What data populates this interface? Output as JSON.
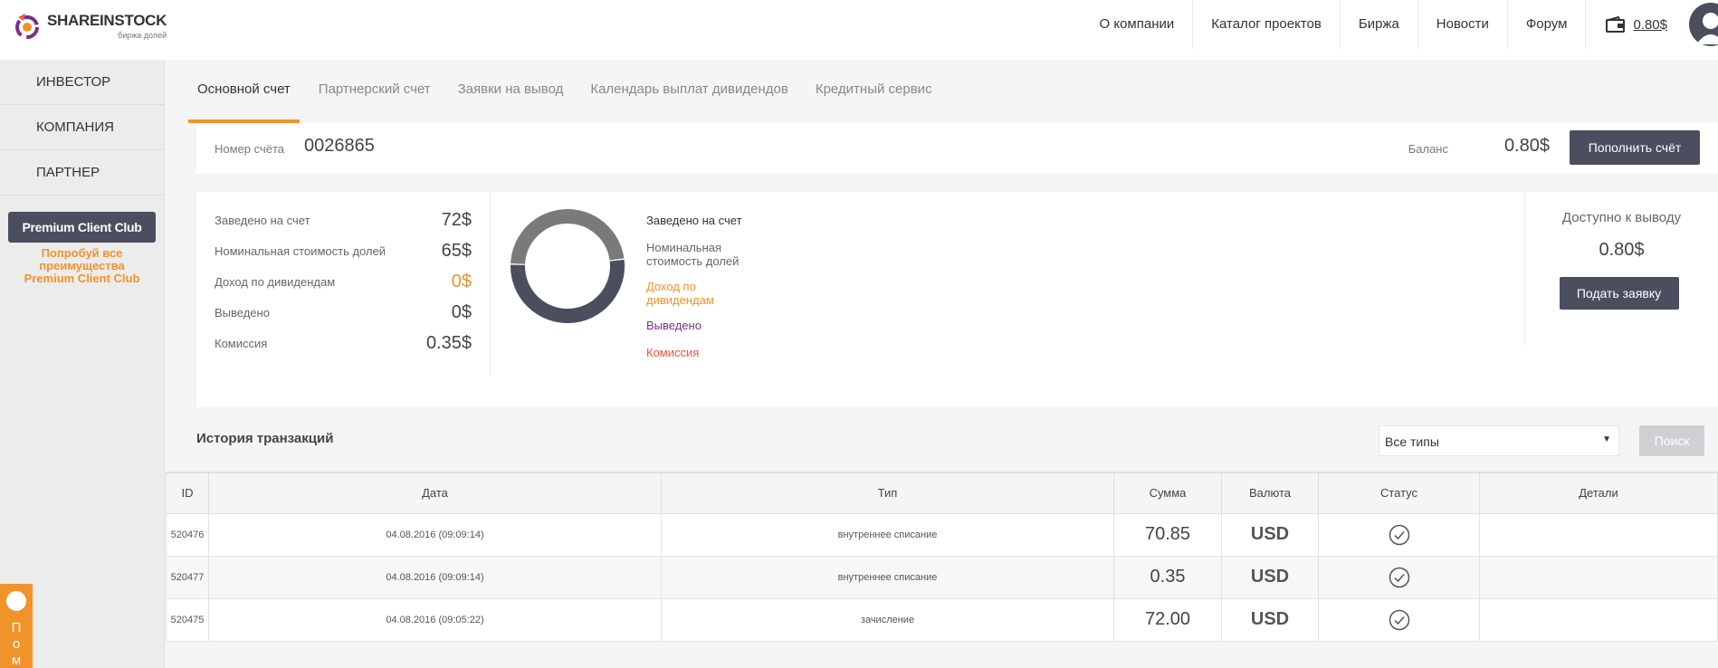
{
  "brand": {
    "name": "SHAREINSTOCK",
    "tagline": "биржа долей"
  },
  "topnav": {
    "items": [
      "О компании",
      "Каталог проектов",
      "Биржа",
      "Новости",
      "Форум"
    ],
    "wallet_amount": "0.80$"
  },
  "sidebar": {
    "items": [
      "ИНВЕСТОР",
      "КОМПАНИЯ",
      "ПАРТНЕР"
    ],
    "premium_button": "Premium Client Club",
    "premium_promo": "Попробуй все преимущества Premium Client Club",
    "help_letters": [
      "П",
      "о",
      "м"
    ]
  },
  "tabs": [
    "Основной счет",
    "Партнерский счет",
    "Заявки на вывод",
    "Календарь выплат дивидендов",
    "Кредитный сервис"
  ],
  "account": {
    "number_label": "Номер счёта",
    "number": "0026865",
    "balance_label": "Баланс",
    "balance": "0.80$",
    "topup_button": "Пополнить счёт"
  },
  "stats": {
    "rows": [
      {
        "label": "Заведено на счет",
        "value": "72$"
      },
      {
        "label": "Номинальная стоимость долей",
        "value": "65$"
      },
      {
        "label": "Доход по дивидендам",
        "value": "0$"
      },
      {
        "label": "Выведено",
        "value": "0$"
      },
      {
        "label": "Комиссия",
        "value": "0.35$"
      }
    ],
    "legend": [
      {
        "label": "Заведено на счет",
        "color": "#333333"
      },
      {
        "label": "Номинальная стоимость долей",
        "color": "#666666"
      },
      {
        "label": "Доход по дивидендам",
        "color": "#f0932b"
      },
      {
        "label": "Выведено",
        "color": "#7b2f8a"
      },
      {
        "label": "Комиссия",
        "color": "#e8553e"
      }
    ],
    "donut": [
      {
        "name": "Заведено на счет",
        "value": 72,
        "color": "#4a4e5e"
      },
      {
        "name": "Номинальная стоимость долей",
        "value": 65,
        "color": "#7a7a7a"
      }
    ],
    "withdraw_label": "Доступно к выводу",
    "withdraw_value": "0.80$",
    "withdraw_button": "Подать заявку"
  },
  "history": {
    "title": "История транзакций",
    "filter_selected": "Все типы",
    "search_button": "Поиск",
    "columns": [
      "ID",
      "Дата",
      "Тип",
      "Сумма",
      "Валюта",
      "Статус",
      "Детали"
    ],
    "rows": [
      {
        "id": "520476",
        "date": "04.08.2016 (09:09:14)",
        "type": "внутреннее списание",
        "sum": "70.85",
        "currency": "USD",
        "details": ""
      },
      {
        "id": "520477",
        "date": "04.08.2016 (09:09:14)",
        "type": "внутреннее списание",
        "sum": "0.35",
        "currency": "USD",
        "details": ""
      },
      {
        "id": "520475",
        "date": "04.08.2016 (09:05:22)",
        "type": "зачисление",
        "sum": "72.00",
        "currency": "USD",
        "details": ""
      }
    ]
  },
  "colors": {
    "accent": "#f0932b",
    "dark": "#4a4e5e"
  }
}
